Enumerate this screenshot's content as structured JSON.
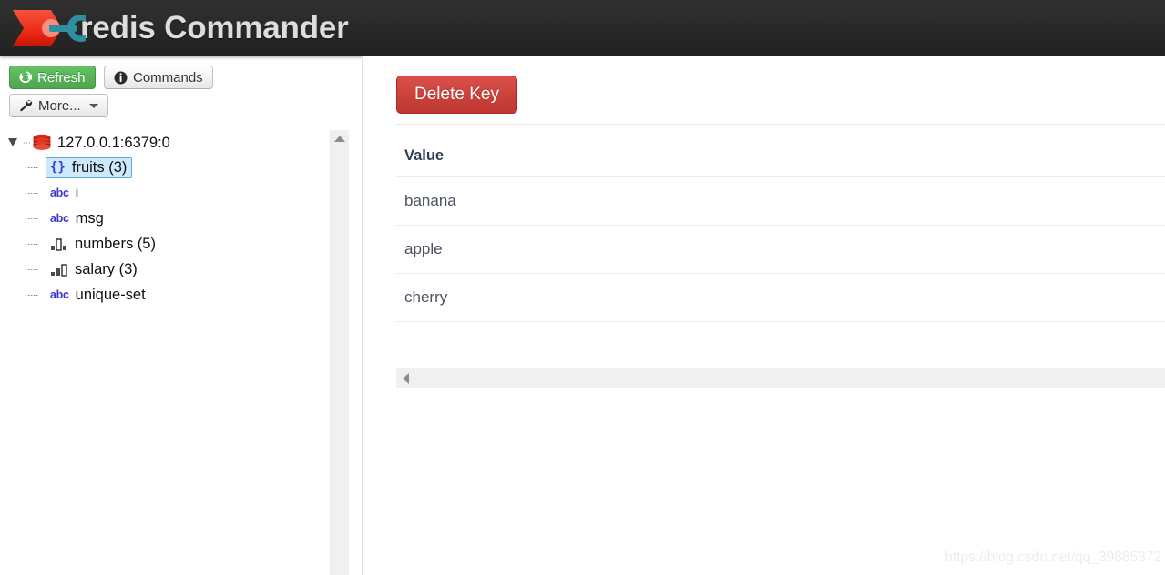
{
  "header": {
    "app_title": "redis Commander",
    "logo_icon": "redis-chevron-key-logo",
    "background_color": "#272727",
    "title_color": "#dddddd"
  },
  "toolbar": {
    "refresh": {
      "label": "Refresh",
      "icon": "refresh-icon",
      "color": "#51a351"
    },
    "commands": {
      "label": "Commands",
      "icon": "info-circle-icon"
    },
    "more": {
      "label": "More...",
      "icon": "wrench-icon",
      "caret": "chevron-down-icon"
    }
  },
  "tree": {
    "root": {
      "label": "127.0.0.1:6379:0",
      "icon": "redis-stack-icon",
      "toggle": "collapse-triangle-icon",
      "expanded": true
    },
    "nodes": [
      {
        "label": "fruits (3)",
        "icon": "hash-braces-icon",
        "icon_glyph": "{}",
        "selected": true
      },
      {
        "label": "i",
        "icon": "string-abc-icon",
        "icon_glyph": "abc",
        "selected": false
      },
      {
        "label": "msg",
        "icon": "string-abc-icon",
        "icon_glyph": "abc",
        "selected": false
      },
      {
        "label": "numbers (5)",
        "icon": "list-bars-icon",
        "icon_glyph": "bars",
        "selected": false
      },
      {
        "label": "salary (3)",
        "icon": "zset-bars-icon",
        "icon_glyph": "bars",
        "selected": false
      },
      {
        "label": "unique-set",
        "icon": "string-abc-icon",
        "icon_glyph": "abc",
        "selected": false
      }
    ],
    "selection_bg": "#cdeafc",
    "selection_border": "#63a6d6"
  },
  "content": {
    "delete_key_label": "Delete Key",
    "delete_key_color": "#bd362f",
    "table": {
      "columns": [
        "Value"
      ],
      "rows": [
        [
          "banana"
        ],
        [
          "apple"
        ],
        [
          "cherry"
        ]
      ]
    },
    "h_scroll_arrow": "scroll-left-arrow-icon"
  },
  "scrollbars": {
    "tree_up_arrow": "scroll-up-arrow-icon"
  },
  "watermark": {
    "text": "https://blog.csdn.net/qq_39885372"
  }
}
